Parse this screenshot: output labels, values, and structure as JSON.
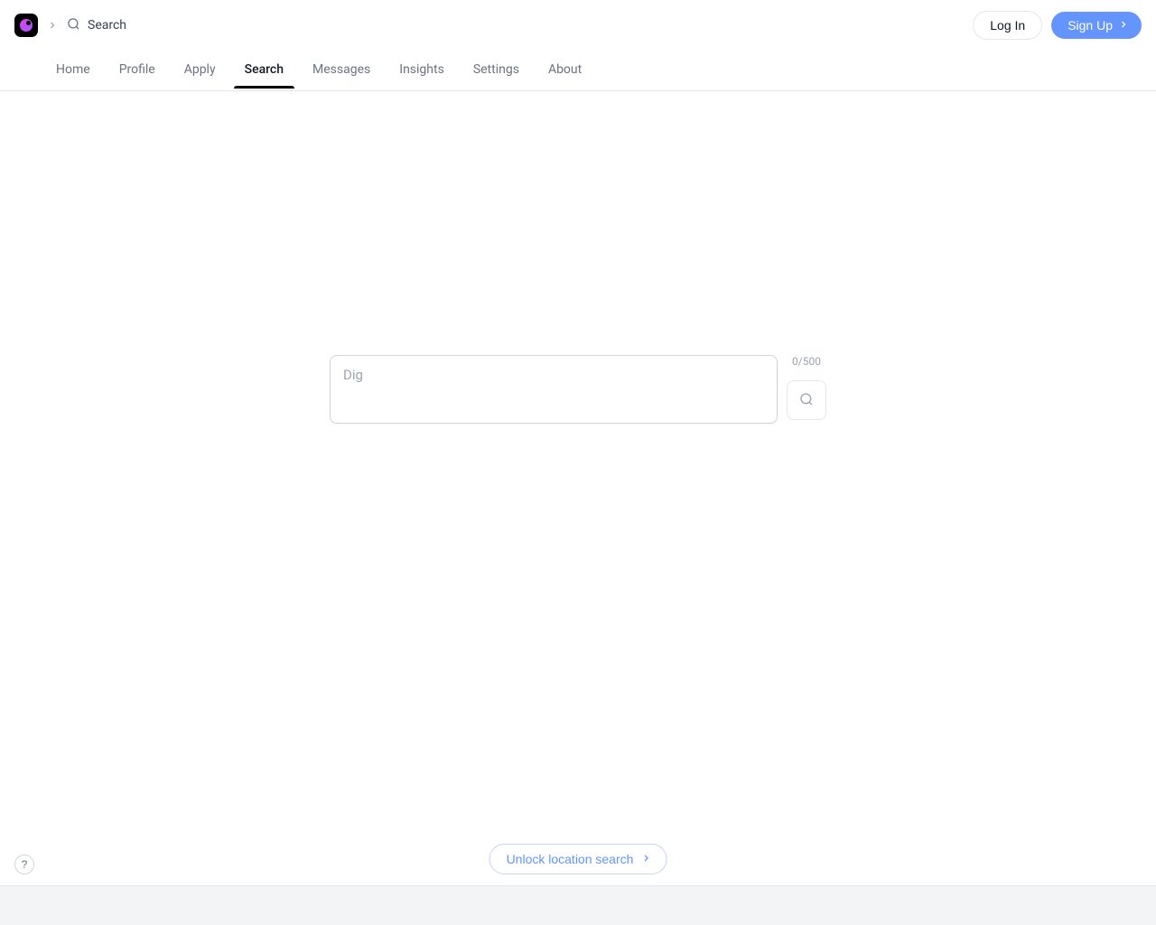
{
  "header": {
    "breadcrumb_label": "Search",
    "login_label": "Log In",
    "signup_label": "Sign Up"
  },
  "tabs": {
    "items": [
      {
        "label": "Home",
        "active": false
      },
      {
        "label": "Profile",
        "active": false
      },
      {
        "label": "Apply",
        "active": false
      },
      {
        "label": "Search",
        "active": true
      },
      {
        "label": "Messages",
        "active": false
      },
      {
        "label": "Insights",
        "active": false
      },
      {
        "label": "Settings",
        "active": false
      },
      {
        "label": "About",
        "active": false
      }
    ]
  },
  "search": {
    "placeholder": "Dig",
    "value": "",
    "char_count": "0/500"
  },
  "unlock": {
    "label": "Unlock location search"
  },
  "help": {
    "label": "?"
  }
}
